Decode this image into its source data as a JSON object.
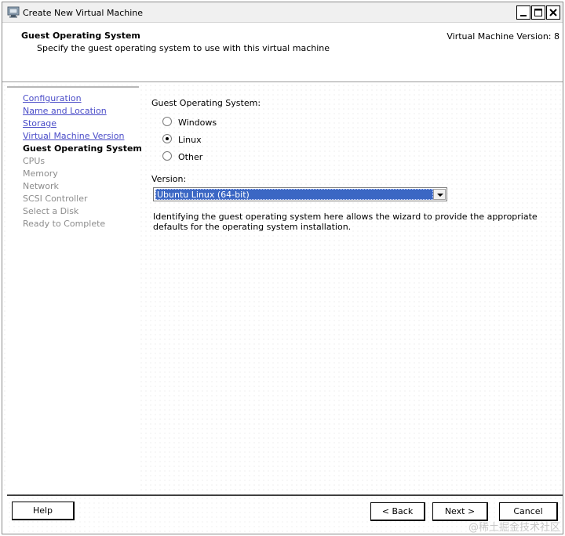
{
  "window": {
    "title": "Create New Virtual Machine",
    "icon": "vm-window-icon",
    "controls": [
      "minimize-icon",
      "maximize-icon",
      "close-icon"
    ]
  },
  "header": {
    "title": "Guest Operating System",
    "subtitle": "Specify the guest operating system to use with this virtual machine",
    "version": "Virtual Machine Version: 8"
  },
  "nav": {
    "items": [
      {
        "label": "Configuration",
        "state": "visited"
      },
      {
        "label": "Name and Location",
        "state": "visited"
      },
      {
        "label": "Storage",
        "state": "visited"
      },
      {
        "label": "Virtual Machine Version",
        "state": "visited"
      },
      {
        "label": "Guest Operating System",
        "state": "current"
      },
      {
        "label": "CPUs",
        "state": "pending"
      },
      {
        "label": "Memory",
        "state": "pending"
      },
      {
        "label": "Network",
        "state": "pending"
      },
      {
        "label": "SCSI Controller",
        "state": "pending"
      },
      {
        "label": "Select a Disk",
        "state": "pending"
      },
      {
        "label": "Ready to Complete",
        "state": "pending"
      }
    ]
  },
  "content": {
    "gos_label": "Guest Operating System:",
    "options": [
      {
        "label": "Windows",
        "selected": false
      },
      {
        "label": "Linux",
        "selected": true
      },
      {
        "label": "Other",
        "selected": false
      }
    ],
    "version_label": "Version:",
    "version_value": "Ubuntu Linux (64-bit)",
    "description": "Identifying the guest operating system here allows the wizard to provide the appropriate defaults for the operating system installation."
  },
  "footer": {
    "help": "Help",
    "back": "< Back",
    "next": "Next >",
    "cancel": "Cancel"
  },
  "watermark": "@稀土掘金技术社区",
  "colors": {
    "link": "#4a4cc8",
    "pending": "#8c8c8c",
    "selection": "#3b67c4"
  }
}
